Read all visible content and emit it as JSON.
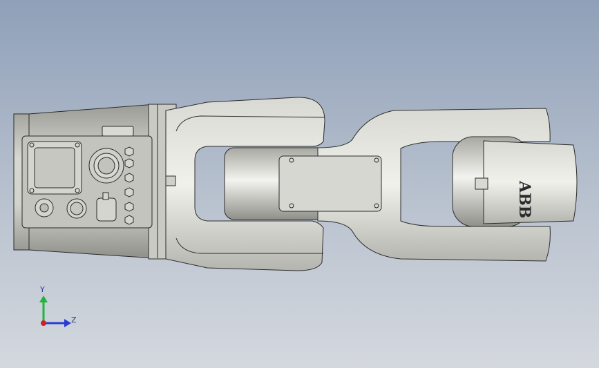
{
  "viewport": {
    "background_top": "#8fa0b8",
    "background_bottom": "#d4d8de"
  },
  "model": {
    "brand_text": "ABB",
    "colors": {
      "body_light": "#e9e9e2",
      "body_mid": "#c7c8c0",
      "body_dark": "#8c8d86",
      "outline": "#2b2b2b",
      "panel": "#b9bab3"
    }
  },
  "triad": {
    "y_label": "Y",
    "z_label": "Z",
    "y_color": "#1fb43a",
    "z_color": "#2a3bd1",
    "x_color": "#d42020"
  }
}
